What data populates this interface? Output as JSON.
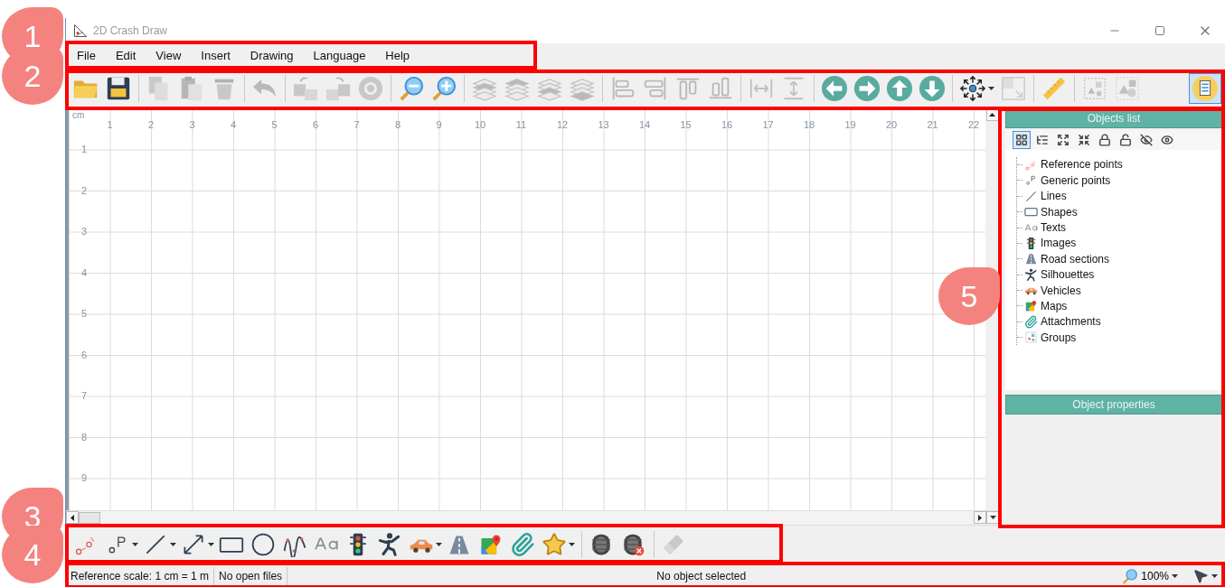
{
  "window": {
    "title": "2D Crash Draw"
  },
  "menu": [
    "File",
    "Edit",
    "View",
    "Insert",
    "Drawing",
    "Language",
    "Help"
  ],
  "toolbar": [
    {
      "kind": "open",
      "disabled": false,
      "pressed": false
    },
    {
      "kind": "save",
      "disabled": false,
      "pressed": false
    },
    {
      "kind": "separator"
    },
    {
      "kind": "copy",
      "disabled": true,
      "pressed": false
    },
    {
      "kind": "paste",
      "disabled": true,
      "pressed": false
    },
    {
      "kind": "delete",
      "disabled": true,
      "pressed": false
    },
    {
      "kind": "separator"
    },
    {
      "kind": "undo",
      "disabled": true,
      "pressed": false
    },
    {
      "kind": "separator"
    },
    {
      "kind": "to-back",
      "disabled": true,
      "pressed": false
    },
    {
      "kind": "to-front",
      "disabled": true,
      "pressed": false
    },
    {
      "kind": "rotate",
      "disabled": true,
      "pressed": false
    },
    {
      "kind": "separator"
    },
    {
      "kind": "zoom-out",
      "disabled": false,
      "pressed": false
    },
    {
      "kind": "zoom-in",
      "disabled": false,
      "pressed": false
    },
    {
      "kind": "separator"
    },
    {
      "kind": "layer-up",
      "disabled": true,
      "pressed": false
    },
    {
      "kind": "layer-top",
      "disabled": true,
      "pressed": false
    },
    {
      "kind": "layer-down",
      "disabled": true,
      "pressed": false
    },
    {
      "kind": "layer-bottom",
      "disabled": true,
      "pressed": false
    },
    {
      "kind": "separator"
    },
    {
      "kind": "align-left",
      "disabled": true,
      "pressed": false
    },
    {
      "kind": "align-right",
      "disabled": true,
      "pressed": false
    },
    {
      "kind": "align-top",
      "disabled": true,
      "pressed": false
    },
    {
      "kind": "align-bottom",
      "disabled": true,
      "pressed": false
    },
    {
      "kind": "separator"
    },
    {
      "kind": "same-width",
      "disabled": true,
      "pressed": false
    },
    {
      "kind": "same-height",
      "disabled": true,
      "pressed": false
    },
    {
      "kind": "separator"
    },
    {
      "kind": "move-left",
      "disabled": false,
      "pressed": false
    },
    {
      "kind": "move-right",
      "disabled": false,
      "pressed": false
    },
    {
      "kind": "move-up",
      "disabled": false,
      "pressed": false
    },
    {
      "kind": "move-down",
      "disabled": false,
      "pressed": false
    },
    {
      "kind": "separator"
    },
    {
      "kind": "handles",
      "disabled": false,
      "pressed": false,
      "dropdown": true
    },
    {
      "kind": "resize",
      "disabled": true,
      "pressed": false
    },
    {
      "kind": "separator"
    },
    {
      "kind": "ruler",
      "disabled": false,
      "pressed": false
    },
    {
      "kind": "separator"
    },
    {
      "kind": "group",
      "disabled": true,
      "pressed": false
    },
    {
      "kind": "ungroup",
      "disabled": true,
      "pressed": false
    },
    {
      "kind": "objects-panel",
      "disabled": false,
      "pressed": true
    }
  ],
  "canvas": {
    "unit": "cm",
    "x_labels": [
      "1",
      "2",
      "3",
      "4",
      "5",
      "6",
      "7",
      "8",
      "9",
      "10",
      "11",
      "12",
      "13",
      "14",
      "15",
      "16",
      "17",
      "18",
      "19",
      "20",
      "21",
      "22"
    ],
    "y_labels": [
      "1",
      "2",
      "3",
      "4",
      "5",
      "6",
      "7",
      "8",
      "9"
    ]
  },
  "objects_list": {
    "title": "Objects list",
    "tools": [
      {
        "kind": "grid-view",
        "selected": true
      },
      {
        "kind": "tree-view",
        "selected": false
      },
      {
        "kind": "expand",
        "selected": false
      },
      {
        "kind": "collapse",
        "selected": false
      },
      {
        "kind": "lock",
        "selected": false
      },
      {
        "kind": "unlock",
        "selected": false
      },
      {
        "kind": "hide",
        "selected": false
      },
      {
        "kind": "show",
        "selected": false
      }
    ],
    "items": [
      {
        "label": "Reference points",
        "kind": "reference-points"
      },
      {
        "label": "Generic points",
        "kind": "generic-point"
      },
      {
        "label": "Lines",
        "kind": "line"
      },
      {
        "label": "Shapes",
        "kind": "rectangle"
      },
      {
        "label": "Texts",
        "kind": "text"
      },
      {
        "label": "Images",
        "kind": "traffic-light"
      },
      {
        "label": "Road sections",
        "kind": "road"
      },
      {
        "label": "Silhouettes",
        "kind": "silhouette"
      },
      {
        "label": "Vehicles",
        "kind": "car"
      },
      {
        "label": "Maps",
        "kind": "map"
      },
      {
        "label": "Attachments",
        "kind": "attachment"
      },
      {
        "label": "Groups",
        "kind": "group"
      }
    ]
  },
  "object_properties": {
    "title": "Object properties"
  },
  "drawing_tools": [
    {
      "kind": "reference-points",
      "disabled": false,
      "dropdown": false
    },
    {
      "kind": "generic-point",
      "disabled": false,
      "dropdown": true
    },
    {
      "kind": "line",
      "disabled": false,
      "dropdown": true
    },
    {
      "kind": "arrow",
      "disabled": false,
      "dropdown": true
    },
    {
      "kind": "rectangle",
      "disabled": false,
      "dropdown": false
    },
    {
      "kind": "circle",
      "disabled": false,
      "dropdown": false
    },
    {
      "kind": "curve",
      "disabled": false,
      "dropdown": false
    },
    {
      "kind": "text",
      "disabled": false,
      "dropdown": false
    },
    {
      "kind": "traffic-light",
      "disabled": false,
      "dropdown": false
    },
    {
      "kind": "silhouette",
      "disabled": false,
      "dropdown": false
    },
    {
      "kind": "car",
      "disabled": false,
      "dropdown": true
    },
    {
      "kind": "road",
      "disabled": false,
      "dropdown": false
    },
    {
      "kind": "map",
      "disabled": false,
      "dropdown": false
    },
    {
      "kind": "attachment",
      "disabled": false,
      "dropdown": false
    },
    {
      "kind": "star",
      "disabled": false,
      "dropdown": true
    },
    {
      "kind": "separator"
    },
    {
      "kind": "tire",
      "disabled": false,
      "dropdown": false
    },
    {
      "kind": "tire-remove",
      "disabled": false,
      "dropdown": false
    },
    {
      "kind": "separator"
    },
    {
      "kind": "eraser",
      "disabled": true,
      "dropdown": false
    }
  ],
  "status_bar": {
    "scale": "Reference scale: 1 cm = 1 m",
    "file": "No open files",
    "selection": "No object selected",
    "zoom": "100%"
  },
  "callouts": [
    {
      "label": "1"
    },
    {
      "label": "2"
    },
    {
      "label": "3"
    },
    {
      "label": "4"
    },
    {
      "label": "5"
    }
  ]
}
